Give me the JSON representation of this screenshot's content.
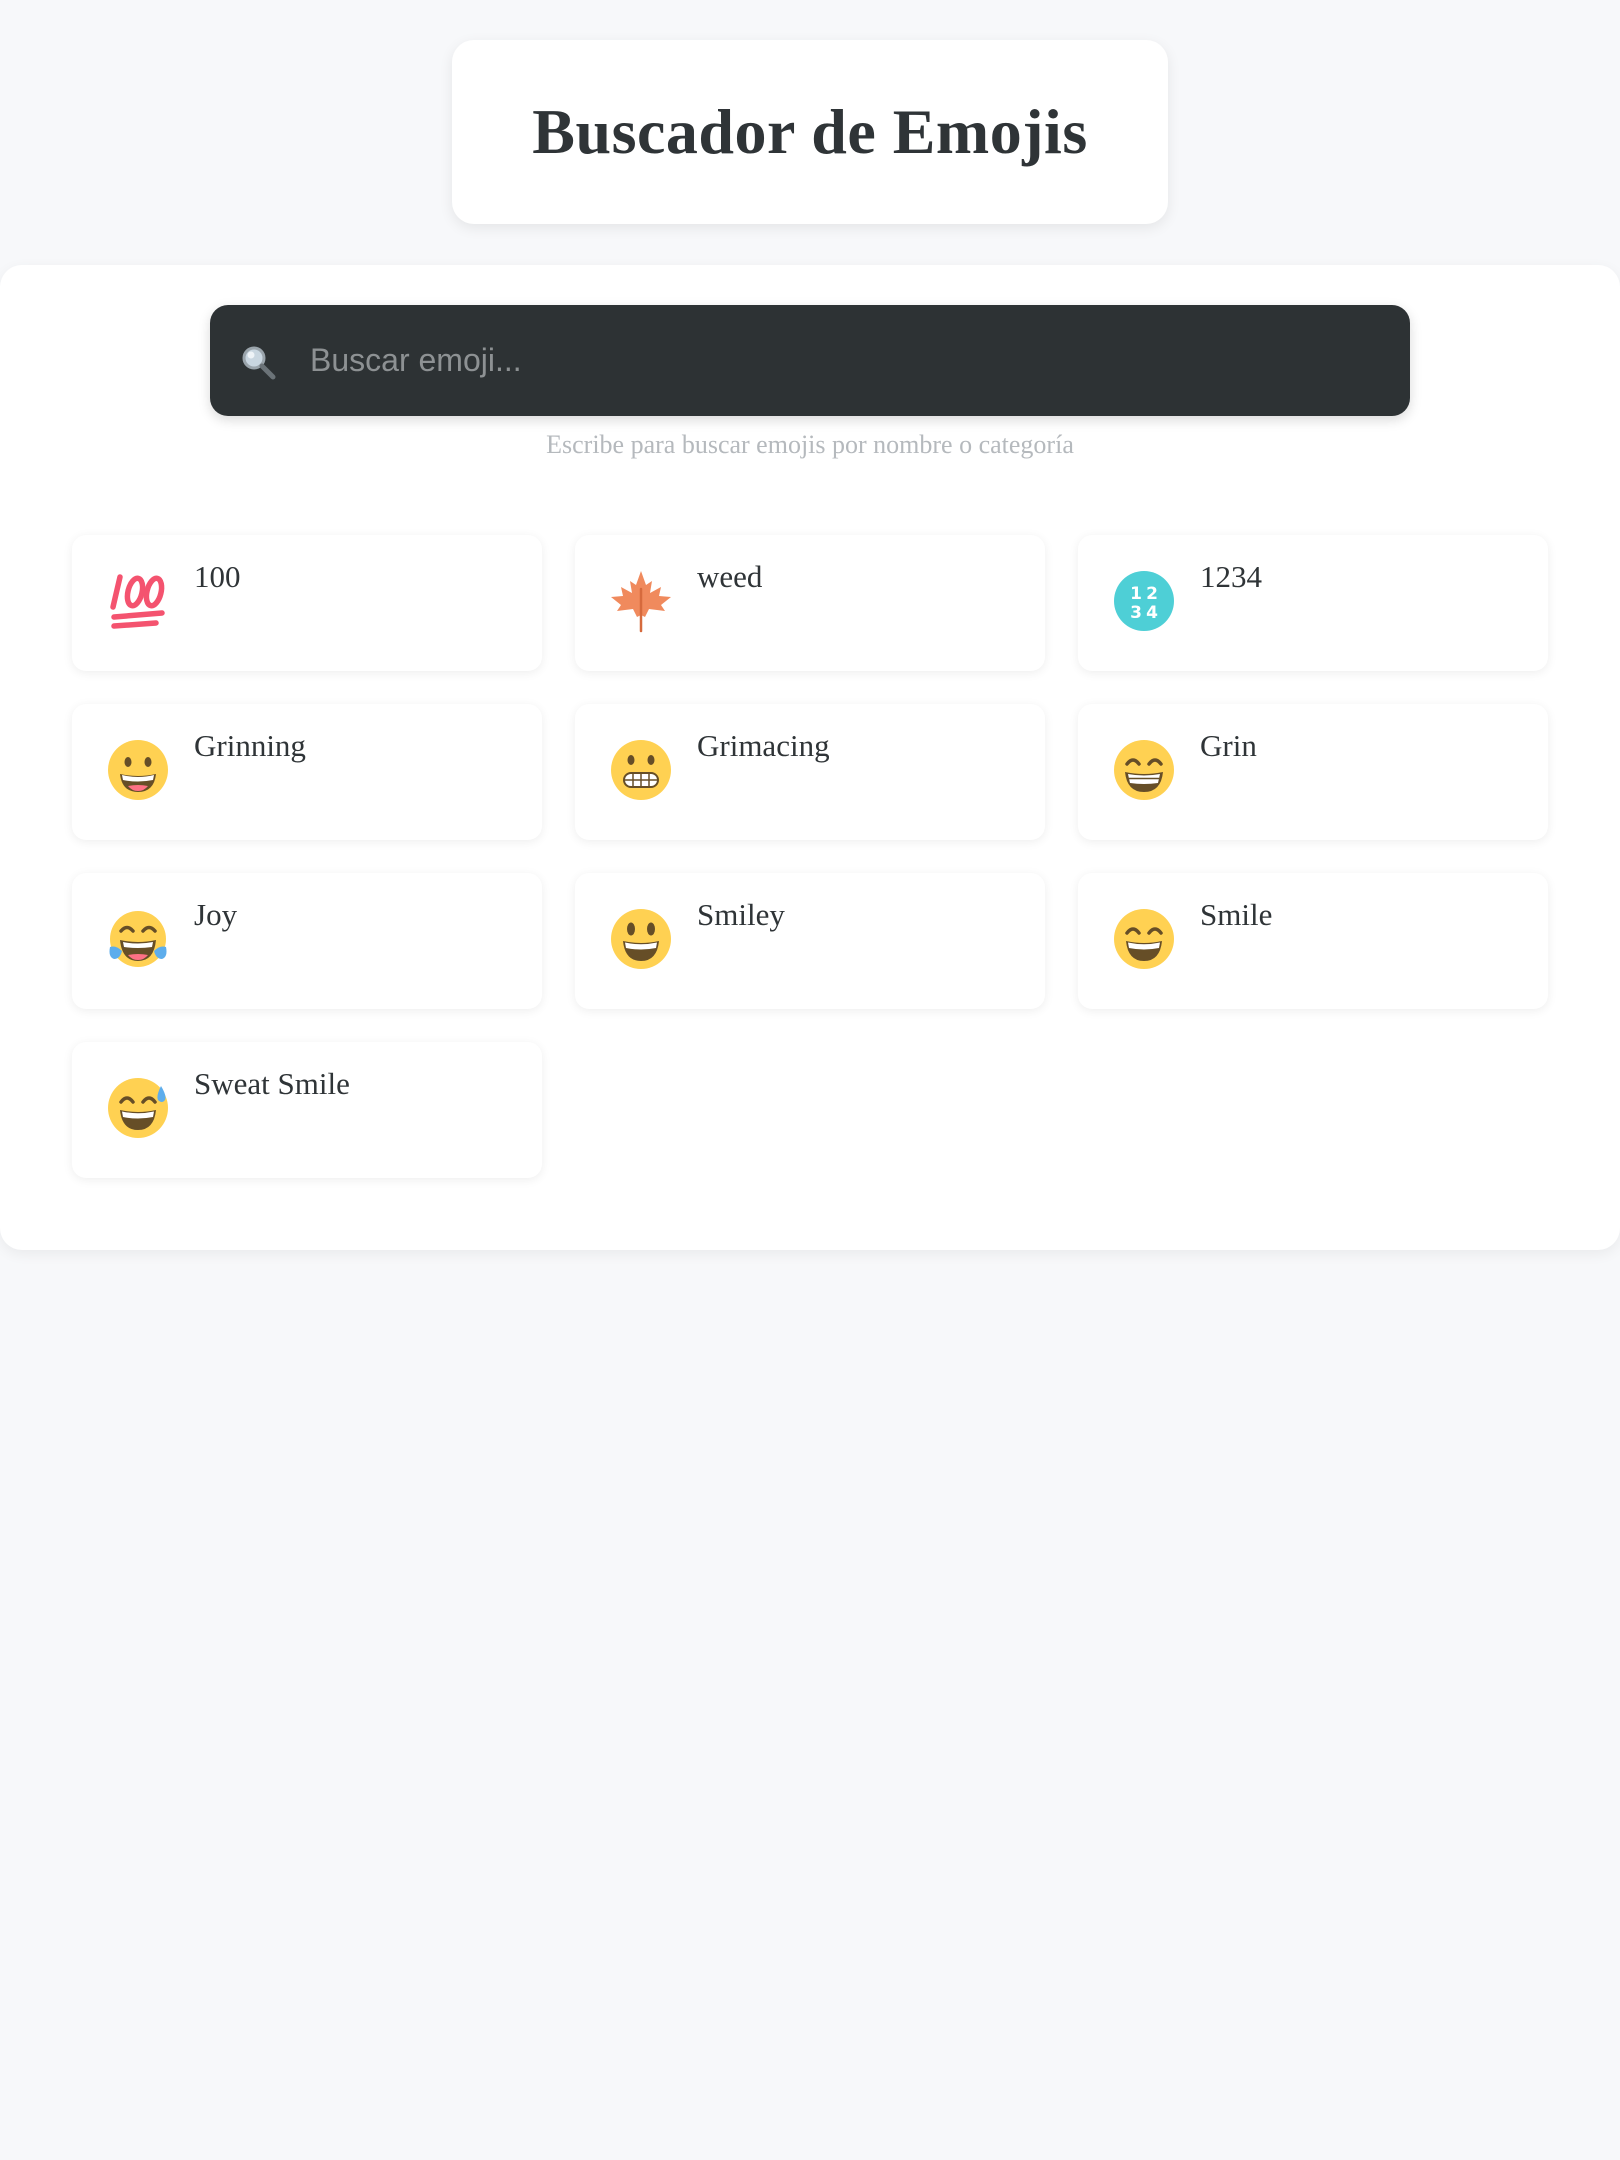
{
  "header": {
    "title": "Buscador de Emojis"
  },
  "search": {
    "placeholder": "Buscar emoji...",
    "value": "",
    "hint": "Escribe para buscar emojis por nombre o categoría"
  },
  "results": [
    {
      "name": "100",
      "icon": "hundred-points-icon"
    },
    {
      "name": "weed",
      "icon": "maple-leaf-icon"
    },
    {
      "name": "1234",
      "icon": "input-numbers-icon"
    },
    {
      "name": "Grinning",
      "icon": "grinning-face-icon"
    },
    {
      "name": "Grimacing",
      "icon": "grimacing-face-icon"
    },
    {
      "name": "Grin",
      "icon": "beaming-face-icon"
    },
    {
      "name": "Joy",
      "icon": "tears-of-joy-icon"
    },
    {
      "name": "Smiley",
      "icon": "smiley-face-icon"
    },
    {
      "name": "Smile",
      "icon": "smile-face-icon"
    },
    {
      "name": "Sweat Smile",
      "icon": "sweat-smile-face-icon"
    }
  ],
  "colors": {
    "background": "#f7f8fa",
    "search_bar": "#2d3234",
    "emoji_face": "#ffd152",
    "hundred_red": "#f4536f",
    "leaf_orange": "#f08a5d",
    "numbers_teal": "#4ecfd6",
    "tear_blue": "#5dadec"
  }
}
